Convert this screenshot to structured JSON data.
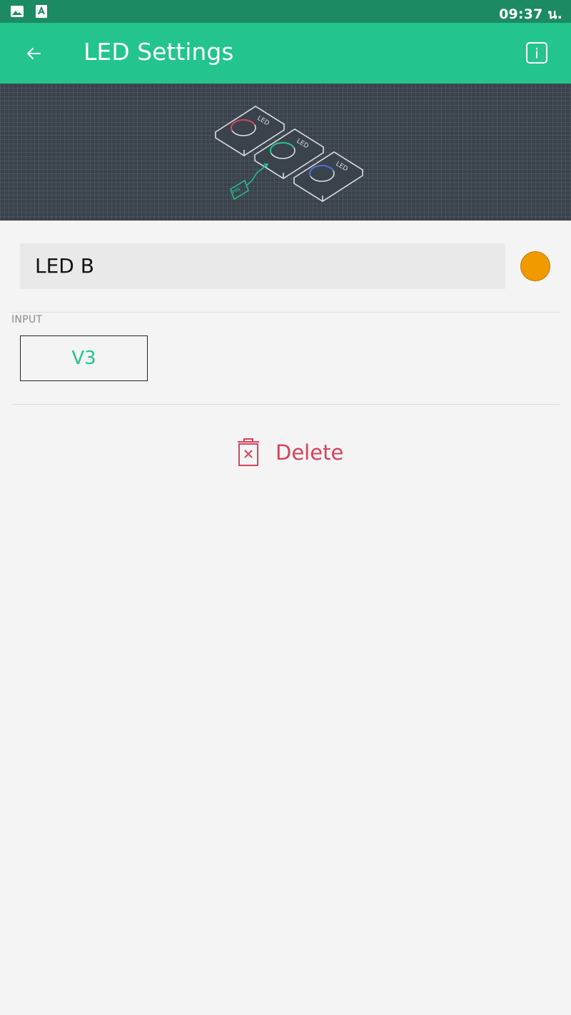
{
  "status_bar": {
    "time": "09:37 น.",
    "icons": [
      "image-icon",
      "app-notification-icon"
    ]
  },
  "header": {
    "title": "LED Settings",
    "back_icon": "arrow-left-icon",
    "info_icon": "info-icon"
  },
  "banner": {
    "led_labels": [
      "LED",
      "LED",
      "LED"
    ],
    "pin_label": "PIN"
  },
  "form": {
    "name_value": "LED B",
    "color_value": "#f09a00",
    "input_section_label": "INPUT",
    "pin_value": "V3"
  },
  "actions": {
    "delete_label": "Delete",
    "delete_icon": "trash-icon"
  },
  "colors": {
    "status_bar": "#1c8a63",
    "app_bar": "#23c48e",
    "accent_green": "#23c48e",
    "delete_red": "#d3435c",
    "led_red": "#d3435c",
    "led_green": "#23c48e",
    "led_blue": "#4a6fd8"
  }
}
